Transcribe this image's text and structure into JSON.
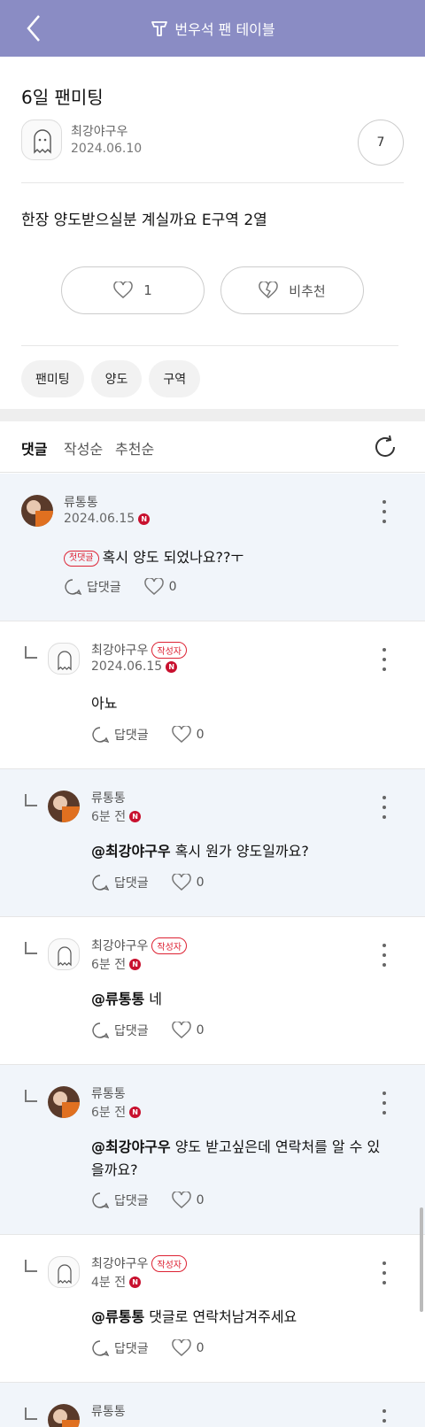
{
  "header": {
    "title": "번우석 팬 테이블"
  },
  "post": {
    "title": "6일 팬미팅",
    "author": "최강야구우",
    "date": "2024.06.10",
    "count": "7",
    "body": "한장 양도받으실분 계실까요 E구역 2열",
    "like_count": "1",
    "dislike_label": "비추천",
    "tags": [
      "팬미팅",
      "양도",
      "구역"
    ]
  },
  "comments_header": {
    "title": "댓글",
    "sort_options": [
      "작성순",
      "추천순"
    ]
  },
  "labels": {
    "reply": "답댓글",
    "writer_badge": "작성자",
    "first_comment_badge": "첫댓글",
    "n_badge": "N"
  },
  "comments": [
    {
      "name": "류통통",
      "date": "2024.06.15",
      "mention": "",
      "text": "혹시 양도 되었나요??ㅜ",
      "likes": "0"
    },
    {
      "name": "최강야구우",
      "date": "2024.06.15",
      "mention": "",
      "text": "아뇨",
      "likes": "0"
    },
    {
      "name": "류통통",
      "date": "6분 전",
      "mention": "@최강야구우",
      "text": "혹시 원가 양도일까요?",
      "likes": "0"
    },
    {
      "name": "최강야구우",
      "date": "6분 전",
      "mention": "@류통통",
      "text": "네",
      "likes": "0"
    },
    {
      "name": "류통통",
      "date": "6분 전",
      "mention": "@최강야구우",
      "text": "양도 받고싶은데 연락처를 알 수 있을까요?",
      "likes": "0"
    },
    {
      "name": "최강야구우",
      "date": "4분 전",
      "mention": "@류통통",
      "text": "댓글로 연락처남겨주세요",
      "likes": "0"
    },
    {
      "name": "류통통",
      "date": "",
      "mention": "",
      "text": "",
      "likes": ""
    }
  ],
  "colors": {
    "header_bg": "#8a8cc4",
    "highlight_bg": "#f1f5fa",
    "badge_red": "#d22233"
  }
}
